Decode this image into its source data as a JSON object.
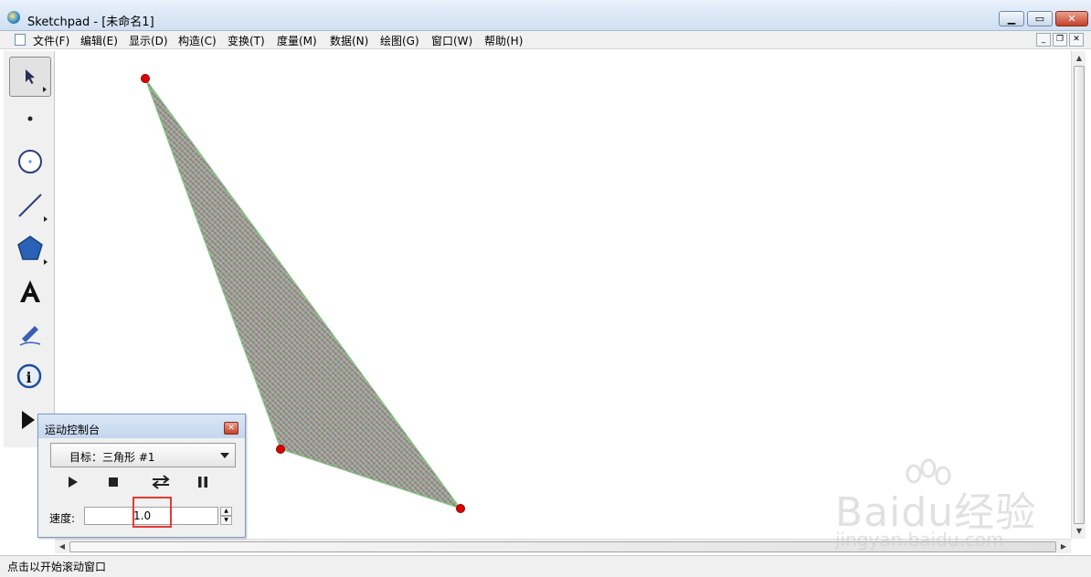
{
  "window": {
    "title": "Sketchpad  - [未命名1]"
  },
  "menu": [
    "文件(F)",
    "编辑(E)",
    "显示(D)",
    "构造(C)",
    "变换(T)",
    "度量(M)",
    "数据(N)",
    "绘图(G)",
    "窗口(W)",
    "帮助(H)"
  ],
  "tools": [
    {
      "name": "arrow-tool-icon",
      "active": true,
      "submenu": true
    },
    {
      "name": "point-tool-icon",
      "active": false,
      "submenu": false
    },
    {
      "name": "compass-tool-icon",
      "active": false,
      "submenu": false
    },
    {
      "name": "line-tool-icon",
      "active": false,
      "submenu": true
    },
    {
      "name": "polygon-tool-icon",
      "active": false,
      "submenu": true
    },
    {
      "name": "text-tool-icon",
      "active": false,
      "submenu": false
    },
    {
      "name": "marker-tool-icon",
      "active": false,
      "submenu": false
    },
    {
      "name": "info-tool-icon",
      "active": false,
      "submenu": false
    },
    {
      "name": "custom-tool-icon",
      "active": false,
      "submenu": false
    }
  ],
  "motion_panel": {
    "title": "运动控制台",
    "target": "目标：三角形 #1",
    "speed_label": "速度:",
    "speed_value": "1.0"
  },
  "status": {
    "text": "点击以开始滚动窗口"
  },
  "watermark": {
    "logo": "Baidu经验",
    "url": "jingyan.baidu.com"
  },
  "colors": {
    "point": "#e00000",
    "fill_a": "#c040c0",
    "fill_b": "#7fd07f",
    "accent": "#e53935"
  }
}
